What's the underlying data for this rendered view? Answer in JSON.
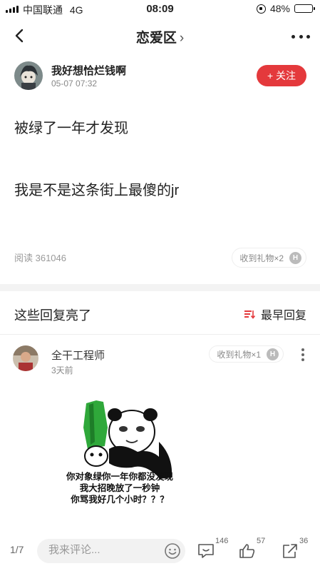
{
  "status_bar": {
    "carrier": "中国联通",
    "network": "4G",
    "time": "08:09",
    "battery": "48%",
    "battery_level": 0.48
  },
  "nav": {
    "title": "恋爱区",
    "chevron": "›"
  },
  "post": {
    "author_name": "我好想恰烂钱啊",
    "date": "05-07 07:32",
    "follow_label": "+ 关注",
    "line1": "被绿了一年才发现",
    "line2": "我是不是这条街上最傻的jr",
    "reads": "阅读 361046",
    "gifts": "收到礼物×2",
    "gift_badge": "H"
  },
  "replies": {
    "section_title": "这些回复亮了",
    "sort_label": "最早回复"
  },
  "comment": {
    "author_name": "全干工程师",
    "time": "3天前",
    "gifts": "收到礼物×1",
    "gift_badge": "H",
    "meme_lines": [
      "你对象绿你一年你都没发现",
      "我大招晚放了一秒钟",
      "你骂我好几个小时？？？"
    ]
  },
  "bottom_bar": {
    "page_indicator": "1/7",
    "input_placeholder": "我来评论...",
    "comment_count": "146",
    "like_count": "57",
    "share_count": "36"
  },
  "colors": {
    "accent": "#e4393c",
    "text": "#222222",
    "muted": "#999999"
  },
  "icons": [
    "back-icon",
    "chevron-right-icon",
    "more-icon",
    "sort-icon",
    "emoji-icon",
    "comment-icon",
    "like-icon",
    "share-icon"
  ]
}
